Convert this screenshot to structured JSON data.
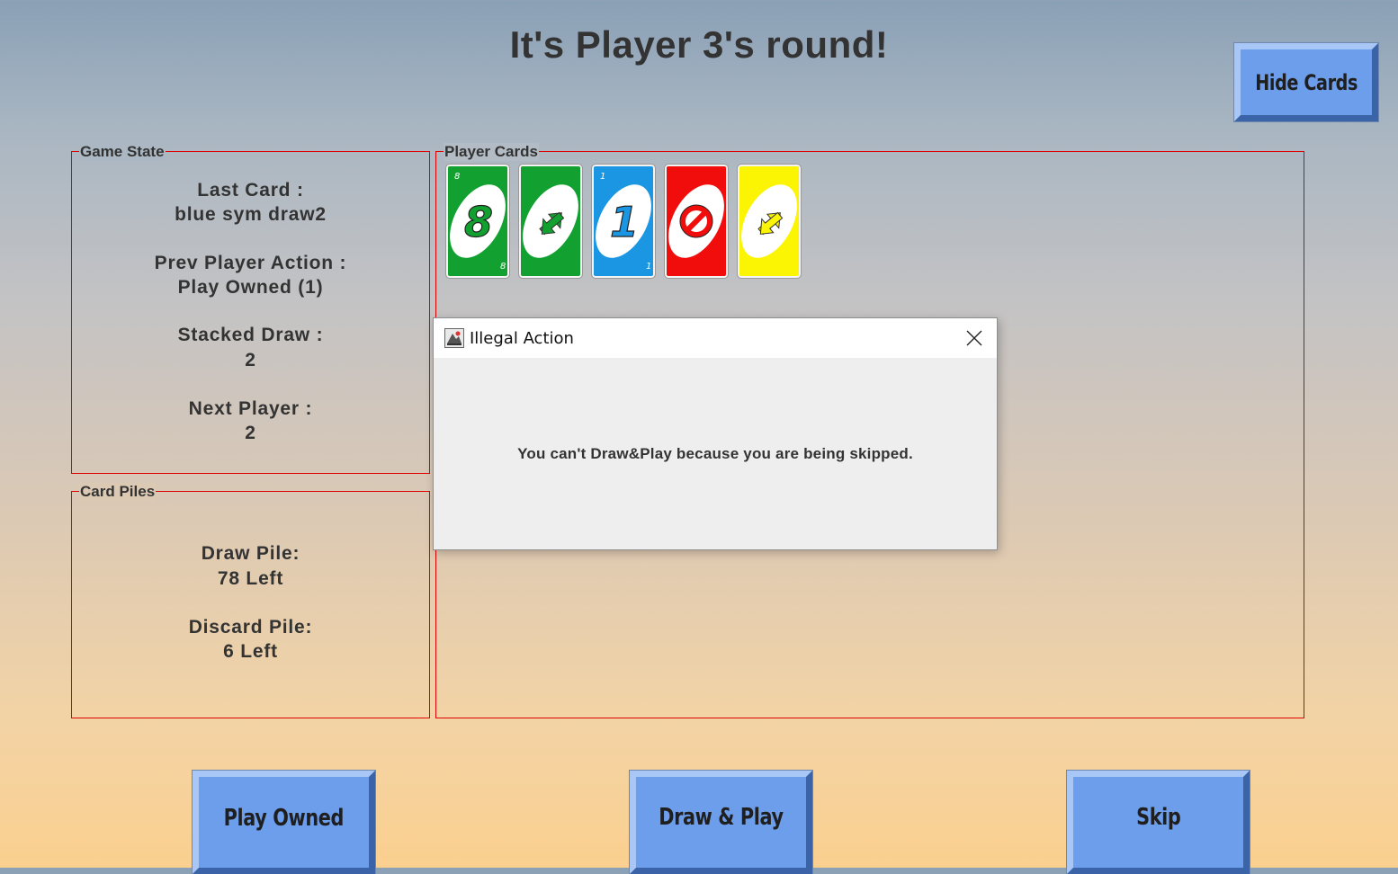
{
  "header": {
    "title": "It's Player 3's round!"
  },
  "buttons": {
    "hide_cards": "Hide Cards",
    "play_owned": "Play Owned",
    "draw_play": "Draw & Play",
    "skip": "Skip"
  },
  "game_state": {
    "legend": "Game State",
    "last_card_label": "Last Card :",
    "last_card_value": "blue sym draw2",
    "prev_action_label": "Prev Player Action :",
    "prev_action_value": "Play Owned (1)",
    "stacked_draw_label": "Stacked Draw :",
    "stacked_draw_value": "2",
    "next_player_label": "Next Player :",
    "next_player_value": "2"
  },
  "card_piles": {
    "legend": "Card Piles",
    "draw_pile_label": "Draw Pile:",
    "draw_pile_value": "78 Left",
    "discard_pile_label": "Discard Pile:",
    "discard_pile_value": "6 Left"
  },
  "player_cards": {
    "legend": "Player Cards",
    "cards": [
      {
        "color": "green",
        "hex": "#12a131",
        "face": "8",
        "icon": "number-8-card"
      },
      {
        "color": "green",
        "hex": "#12a131",
        "face": "reverse",
        "icon": "reverse-card"
      },
      {
        "color": "blue",
        "hex": "#1a96e3",
        "face": "1",
        "icon": "number-1-card"
      },
      {
        "color": "red",
        "hex": "#f20d0d",
        "face": "skip",
        "icon": "skip-card"
      },
      {
        "color": "yellow",
        "hex": "#fbf403",
        "face": "reverse",
        "icon": "reverse-card"
      }
    ]
  },
  "dialog": {
    "title": "Illegal Action",
    "message": "You can't Draw&Play because you are being skipped."
  },
  "colors": {
    "panel_border": "#e00000",
    "button_fill": "#6d9eeb"
  }
}
